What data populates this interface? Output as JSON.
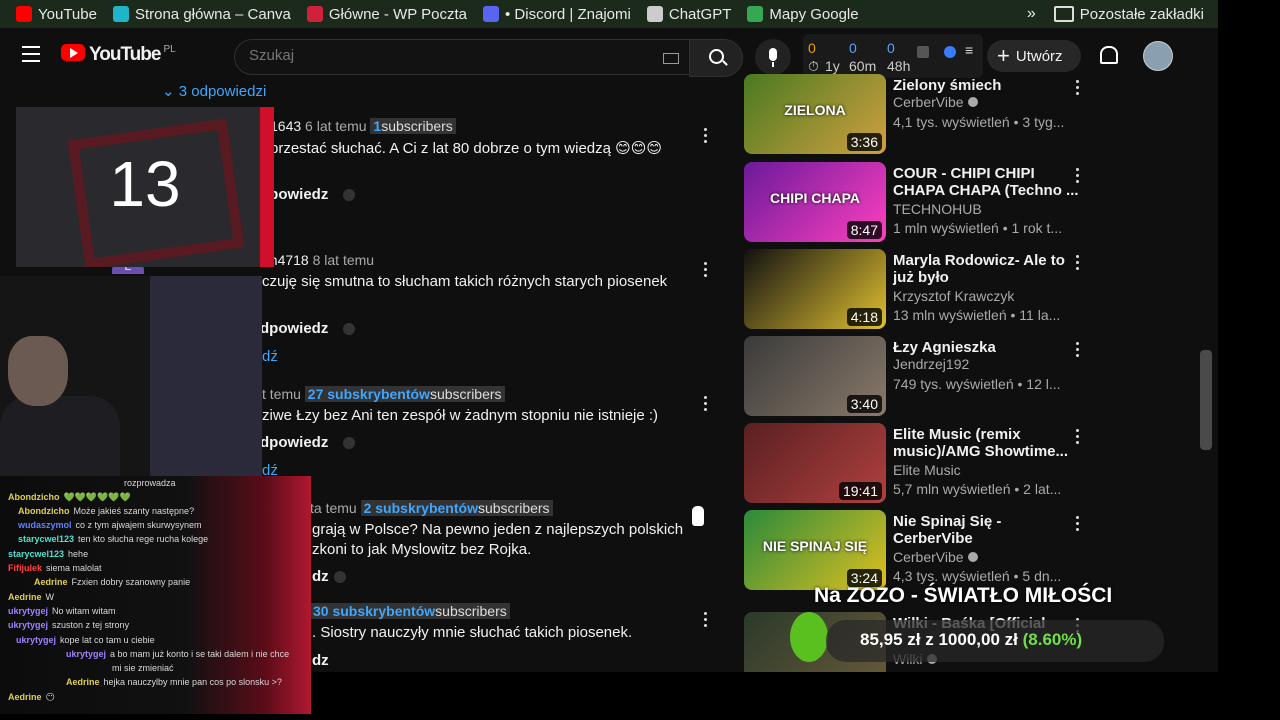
{
  "bookmarks": [
    {
      "label": "YouTube",
      "color": "#ff0000"
    },
    {
      "label": "Strona główna – Canva",
      "color": "#20b4c8"
    },
    {
      "label": "Główne - WP Poczta",
      "color": "#d0203a"
    },
    {
      "label": "• Discord | Znajomi",
      "color": "#5865f2"
    },
    {
      "label": "ChatGPT",
      "color": "#cccccc"
    },
    {
      "label": "Mapy Google",
      "color": "#34a853"
    }
  ],
  "bookmarks_more": "Pozostałe zakładki",
  "header": {
    "logo_text": "YouTube",
    "country": "PL",
    "search_placeholder": "Szukaj",
    "create_label": "Utwórz",
    "ext_counts": [
      "0",
      "0",
      "0"
    ],
    "ext_labels": [
      "1y",
      "60m",
      "48h"
    ]
  },
  "comments": {
    "replies_toggle": "3 odpowiedzi",
    "items": [
      {
        "author": "1643",
        "age": "6 lat temu",
        "chip_num": "1",
        "chip_text": "subscribers",
        "text": "przestać słuchać.  A Ci z lat 80 dobrze o tym wiedzą 😊😊😊",
        "reply": "dpowiedz"
      },
      {
        "author": "on4718",
        "age": "8 lat temu",
        "chip_num": "",
        "chip_text": "",
        "text": "czuję się smutna to słucham takich różnych starych piosenek",
        "reply": "dpowiedz"
      },
      {
        "author": "",
        "age": "t temu",
        "chip_num": "27 subskrybentów",
        "chip_text": "subscribers",
        "text": "ziwe Łzy bez Ani ten zespół w żadnym stopniu nie istnieje :)",
        "reply": "dpowiedz"
      },
      {
        "author": "",
        "age": "ta temu",
        "chip_num": "2 subskrybentów",
        "chip_text": "subscribers",
        "text": "grają w Polsce? Na pewno jeden z najlepszych polskich",
        "text2": "zkoni to jak Myslowitz bez Rojka.",
        "reply": "dz"
      },
      {
        "author": "",
        "age": "",
        "chip_num": "30 subskrybentów",
        "chip_text": "subscribers",
        "text": ". Siostry nauczyły mnie słuchać takich piosenek.",
        "reply": "dz"
      }
    ],
    "fragment_a": "i",
    "fragment_b": "dź",
    "fragment_c": "dź"
  },
  "recs": [
    {
      "title": "Zielony śmiech",
      "channel": "CerberVibe",
      "verified": true,
      "stats": "4,1 tys. wyświetleń • 3 tyg...",
      "dur": "3:36",
      "thumb": "#4a7a20",
      "thumb2": "#d0a040",
      "thumb_text": "ZIELONA"
    },
    {
      "title": "COUR - CHIPI CHIPI CHAPA CHAPA (Techno ...",
      "channel": "TECHNOHUB",
      "verified": false,
      "stats": "1 mln wyświetleń • 1 rok t...",
      "dur": "8:47",
      "thumb": "#6a1a9a",
      "thumb2": "#ff40c0",
      "thumb_text": "CHIPI CHAPA"
    },
    {
      "title": "Maryla Rodowicz- Ale to już było",
      "channel": "Krzysztof Krawczyk",
      "verified": false,
      "stats": "13 mln wyświetleń • 11 la...",
      "dur": "4:18",
      "thumb": "#111111",
      "thumb2": "#e0c030",
      "thumb_text": ""
    },
    {
      "title": "Łzy Agnieszka",
      "channel": "Jendrzej192",
      "verified": false,
      "stats": "749 tys. wyświetleń • 12 l...",
      "dur": "3:40",
      "thumb": "#3a3a3a",
      "thumb2": "#8a7a6a",
      "thumb_text": ""
    },
    {
      "title": "Elite Music (remix music)/AMG Showtime...",
      "channel": "Elite Music",
      "verified": false,
      "stats": "5,7 mln wyświetleń • 2 lat...",
      "dur": "19:41",
      "thumb": "#5a2020",
      "thumb2": "#b04040",
      "thumb_text": ""
    },
    {
      "title": "Nie Spinaj Się - CerberVibe",
      "channel": "CerberVibe",
      "verified": true,
      "stats": "4,3 tys. wyświetleń • 5 dn...",
      "dur": "3:24",
      "thumb": "#2a8a3a",
      "thumb2": "#e0c020",
      "thumb_text": "NIE SPINAJ SIĘ"
    },
    {
      "title": "Wilki - Baśka [Official",
      "channel": "Wilki",
      "verified": true,
      "stats": "",
      "dur": "",
      "thumb": "#2a3a2a",
      "thumb2": "#6a5a3a",
      "thumb_text": ""
    }
  ],
  "overlay": {
    "counter": "13",
    "donation_title": "Na ZOZO - ŚWIATŁO MIŁOŚCI",
    "donation_current": "85,95 zł",
    "donation_sep": "z",
    "donation_goal": "1000,00 zł",
    "donation_pct": "(8.60%)"
  },
  "chat": [
    {
      "user": "",
      "text": "rozprowadza",
      "ucolor": "#ffffff"
    },
    {
      "user": "Abondzicho",
      "text": "💚💚💚💚💚💚",
      "ucolor": "#e0d050"
    },
    {
      "user": "Abondzicho",
      "text": "Może jakieś szanty następne?",
      "ucolor": "#e0d050"
    },
    {
      "user": "wudaszymol",
      "text": "co z tym ajwajem skurwysynem",
      "ucolor": "#6080ff"
    },
    {
      "user": "starycwel123",
      "text": "ten kto słucha rege rucha kolege",
      "ucolor": "#50e0d0"
    },
    {
      "user": "starycwel123",
      "text": "hehe",
      "ucolor": "#50e0d0"
    },
    {
      "user": "Fifijulek",
      "text": "siema malolat",
      "ucolor": "#ff4040"
    },
    {
      "user": "Aedrine",
      "text": "Fzxien dobry szanowny panie",
      "ucolor": "#e0d050"
    },
    {
      "user": "Aedrine",
      "text": "W",
      "ucolor": "#e0d050"
    },
    {
      "user": "ukrytygej",
      "text": "No witam witam",
      "ucolor": "#a080ff"
    },
    {
      "user": "ukrytygej",
      "text": "szuston z tej strony",
      "ucolor": "#a080ff"
    },
    {
      "user": "ukrytygej",
      "text": "kope lat co tam u ciebie",
      "ucolor": "#a080ff"
    },
    {
      "user": "ukrytygej",
      "text": "a bo mam już konto i se taki dalem i nie chce",
      "ucolor": "#a080ff"
    },
    {
      "user": "",
      "text": "mi sie zmieniać",
      "ucolor": "#ffffff"
    },
    {
      "user": "Aedrine",
      "text": "hejka nauczylby mnie pan cos po slonsku >?",
      "ucolor": "#e0d050"
    },
    {
      "user": "Aedrine",
      "text": "😶",
      "ucolor": "#e0d050"
    }
  ]
}
